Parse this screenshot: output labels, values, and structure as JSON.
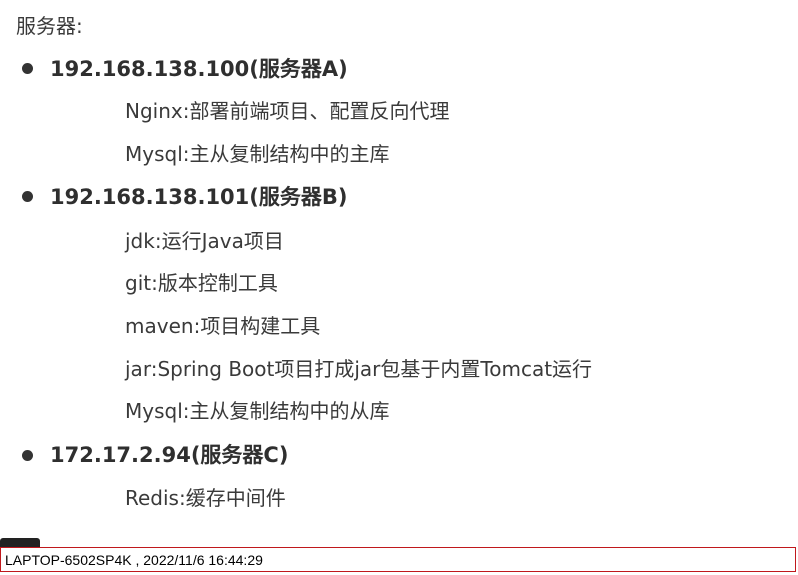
{
  "title": "服务器:",
  "servers": [
    {
      "heading": "192.168.138.100(服务器A)",
      "items": [
        {
          "name": "Nginx",
          "sep": ":",
          "desc": "部署前端项目、配置反向代理"
        },
        {
          "name": "Mysql",
          "sep": ":",
          "desc": "主从复制结构中的主库"
        }
      ]
    },
    {
      "heading": "192.168.138.101(服务器B)",
      "items": [
        {
          "name": "jdk",
          "sep": ":",
          "desc": "运行Java项目"
        },
        {
          "name": "git",
          "sep": ":",
          "desc": "版本控制工具"
        },
        {
          "name": "maven",
          "sep": ":",
          "desc": "项目构建工具"
        },
        {
          "name": "jar",
          "sep": ":",
          "desc": "Spring Boot项目打成jar包基于内置Tomcat运行"
        },
        {
          "name": "Mysql",
          "sep": ":",
          "desc": "主从复制结构中的从库"
        }
      ]
    },
    {
      "heading": "172.17.2.94(服务器C)",
      "items": [
        {
          "name": "Redis",
          "sep": ":",
          "desc": "缓存中间件"
        }
      ]
    }
  ],
  "status_bar": {
    "text": "LAPTOP-6502SP4K ,  2022/11/6 16:44:29",
    "border_color": "#c0181c"
  }
}
